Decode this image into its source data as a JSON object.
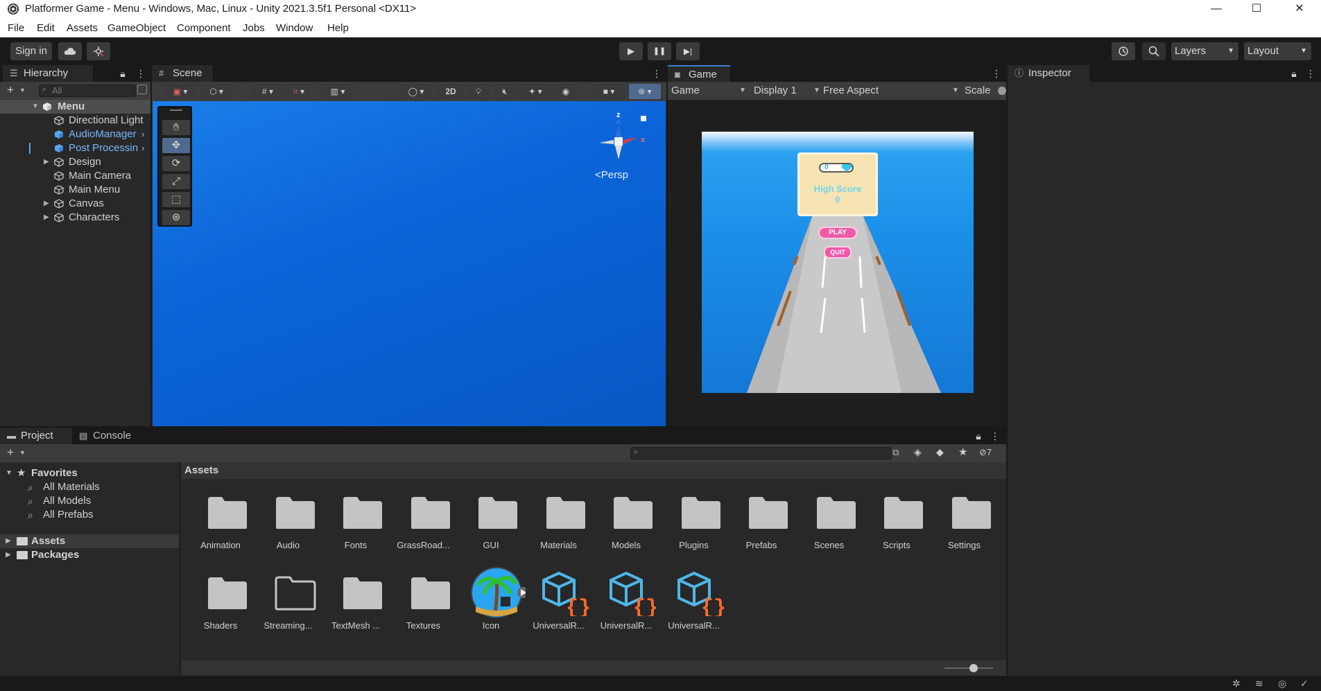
{
  "window": {
    "title": "Platformer Game - Menu - Windows, Mac, Linux - Unity 2021.3.5f1 Personal <DX11>",
    "minimize": "—",
    "maximize": "☐",
    "close": "✕"
  },
  "menubar": [
    "File",
    "Edit",
    "Assets",
    "GameObject",
    "Component",
    "Jobs",
    "Window",
    "Help"
  ],
  "toolbar": {
    "sign_in": "Sign in",
    "cloud_icon": "cloud-icon",
    "collab_icon": "collab-icon",
    "play": "▶",
    "pause": "❚❚",
    "step": "▶|",
    "layers": "Layers",
    "layout": "Layout"
  },
  "hierarchy": {
    "tab": "Hierarchy",
    "search_placeholder": "All",
    "items": [
      {
        "label": "Menu",
        "level": 0,
        "expanded": true,
        "selected": true,
        "prefab": false
      },
      {
        "label": "Directional Light",
        "level": 1,
        "prefab": false
      },
      {
        "label": "AudioManager",
        "level": 1,
        "prefab": true
      },
      {
        "label": "Post Processing",
        "level": 1,
        "prefab": true
      },
      {
        "label": "Design",
        "level": 1,
        "prefab": false,
        "collapsed": true
      },
      {
        "label": "Main Camera",
        "level": 1,
        "prefab": false
      },
      {
        "label": "Main Menu",
        "level": 1,
        "prefab": false
      },
      {
        "label": "Canvas",
        "level": 1,
        "prefab": false,
        "collapsed": true
      },
      {
        "label": "Characters",
        "level": 1,
        "prefab": false,
        "collapsed": true
      }
    ]
  },
  "scene": {
    "tab": "Scene",
    "mode_2d": "2D",
    "gizmo_label": "<Persp",
    "axis_x": "x",
    "axis_z": "z"
  },
  "game": {
    "tab": "Game",
    "display_mode": "Game",
    "display": "Display 1",
    "aspect": "Free Aspect",
    "scale": "Scale",
    "ui": {
      "score_value": "0",
      "high_score_label": "High Score",
      "high_score_value": "0",
      "play_button": "PLAY",
      "quit_button": "QUIT"
    }
  },
  "inspector": {
    "tab": "Inspector"
  },
  "project": {
    "tabs": [
      "Project",
      "Console"
    ],
    "hidden_count": "7",
    "breadcrumb": "Assets",
    "tree": {
      "favorites": "Favorites",
      "favorites_items": [
        "All Materials",
        "All Models",
        "All Prefabs"
      ],
      "assets": "Assets",
      "packages": "Packages"
    },
    "items": [
      {
        "label": "Animation",
        "type": "folder"
      },
      {
        "label": "Audio",
        "type": "folder"
      },
      {
        "label": "Fonts",
        "type": "folder"
      },
      {
        "label": "GrassRoad...",
        "type": "folder"
      },
      {
        "label": "GUI",
        "type": "folder"
      },
      {
        "label": "Materials",
        "type": "folder"
      },
      {
        "label": "Models",
        "type": "folder"
      },
      {
        "label": "Plugins",
        "type": "folder"
      },
      {
        "label": "Prefabs",
        "type": "folder"
      },
      {
        "label": "Scenes",
        "type": "folder"
      },
      {
        "label": "Scripts",
        "type": "folder"
      },
      {
        "label": "Settings",
        "type": "folder"
      },
      {
        "label": "Shaders",
        "type": "folder"
      },
      {
        "label": "Streaming...",
        "type": "folder-empty"
      },
      {
        "label": "TextMesh ...",
        "type": "folder"
      },
      {
        "label": "Textures",
        "type": "folder"
      },
      {
        "label": "Icon",
        "type": "image"
      },
      {
        "label": "UniversalR...",
        "type": "asset"
      },
      {
        "label": "UniversalR...",
        "type": "asset"
      },
      {
        "label": "UniversalR...",
        "type": "asset"
      }
    ]
  },
  "colors": {
    "scene_blue": "#0b64d8",
    "prefab_blue": "#7ab8ff",
    "panel_bg": "#282828",
    "toolbar_bg": "#191919",
    "asset_orange": "#ff6a2b",
    "asset_blue": "#4fb6e8"
  }
}
